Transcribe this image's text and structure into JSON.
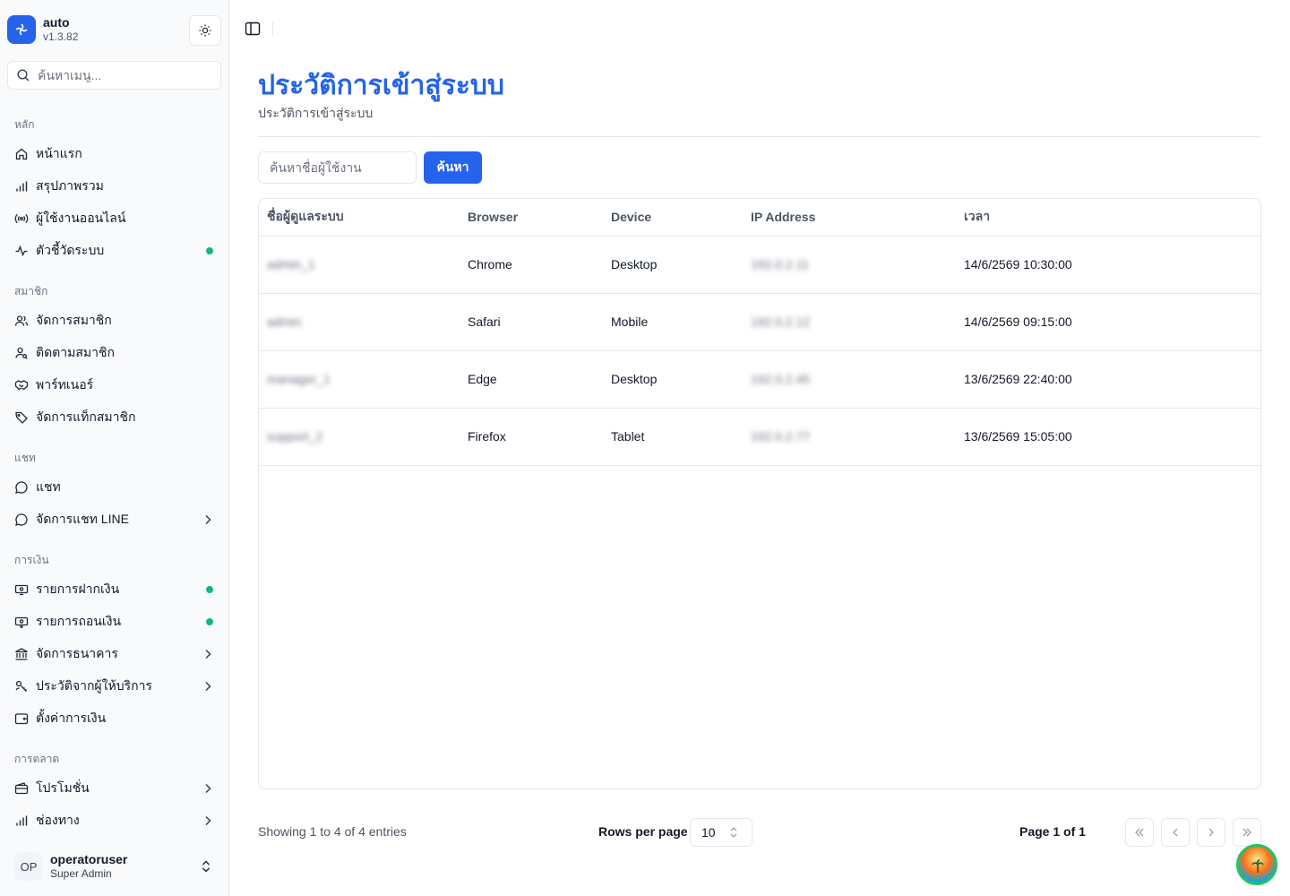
{
  "app": {
    "name": "auto",
    "version": "v1.3.82"
  },
  "sidebar": {
    "search_placeholder": "ค้นหาเมนู...",
    "groups": [
      {
        "label": "หลัก",
        "items": [
          {
            "label": "หน้าแรก",
            "icon": "home-icon"
          },
          {
            "label": "สรุปภาพรวม",
            "icon": "bar-chart-icon"
          },
          {
            "label": "ผู้ใช้งานออนไลน์",
            "icon": "radio-icon"
          },
          {
            "label": "ตัวชี้วัดระบบ",
            "icon": "activity-icon",
            "status_dot": "#10b981"
          }
        ]
      },
      {
        "label": "สมาชิก",
        "items": [
          {
            "label": "จัดการสมาชิก",
            "icon": "users-icon"
          },
          {
            "label": "ติดตามสมาชิก",
            "icon": "user-search-icon"
          },
          {
            "label": "พาร์ทเนอร์",
            "icon": "handshake-icon"
          },
          {
            "label": "จัดการแท็กสมาชิก",
            "icon": "tag-icon"
          }
        ]
      },
      {
        "label": "แชท",
        "items": [
          {
            "label": "แชท",
            "icon": "message-circle-icon"
          },
          {
            "label": "จัดการแชท LINE",
            "icon": "message-circle-icon",
            "expandable": true
          }
        ]
      },
      {
        "label": "การเงิน",
        "items": [
          {
            "label": "รายการฝากเงิน",
            "icon": "deposit-icon",
            "status_dot": "#10b981"
          },
          {
            "label": "รายการถอนเงิน",
            "icon": "withdraw-icon",
            "status_dot": "#10b981"
          },
          {
            "label": "จัดการธนาคาร",
            "icon": "bank-icon",
            "expandable": true
          },
          {
            "label": "ประวัติจากผู้ให้บริการ",
            "icon": "provider-history-icon",
            "expandable": true
          },
          {
            "label": "ตั้งค่าการเงิน",
            "icon": "wallet-icon"
          }
        ]
      },
      {
        "label": "การตลาด",
        "items": [
          {
            "label": "โปรโมชั่น",
            "icon": "wallet-card-icon",
            "expandable": true
          },
          {
            "label": "ช่องทาง",
            "icon": "bar-chart-icon",
            "expandable": true
          }
        ]
      }
    ],
    "user": {
      "initials": "OP",
      "name": "operatoruser",
      "role": "Super Admin"
    }
  },
  "page": {
    "title": "ประวัติการเข้าสู่ระบบ",
    "subtitle": "ประวัติการเข้าสู่ระบบ",
    "filter_placeholder": "ค้นหาชื่อผู้ใช้งาน",
    "search_button": "ค้นหา"
  },
  "table": {
    "columns": [
      "ชื่อผู้ดูแลระบบ",
      "Browser",
      "Device",
      "IP Address",
      "เวลา"
    ],
    "rows": [
      {
        "admin": "admin_1",
        "browser": "Chrome",
        "device": "Desktop",
        "ip": "192.0.2.11",
        "time": "14/6/2569 10:30:00"
      },
      {
        "admin": "admin",
        "browser": "Safari",
        "device": "Mobile",
        "ip": "192.0.2.12",
        "time": "14/6/2569 09:15:00"
      },
      {
        "admin": "manager_1",
        "browser": "Edge",
        "device": "Desktop",
        "ip": "192.0.2.45",
        "time": "13/6/2569 22:40:00"
      },
      {
        "admin": "support_2",
        "browser": "Firefox",
        "device": "Tablet",
        "ip": "192.0.2.77",
        "time": "13/6/2569 15:05:00"
      }
    ]
  },
  "pagination": {
    "info": "Showing 1 to 4 of 4 entries",
    "rows_per_page_label": "Rows per page",
    "rows_per_page": "10",
    "page_label": "Page 1 of 1"
  },
  "colors": {
    "accent": "#2563eb",
    "status_dot": "#10b981"
  }
}
